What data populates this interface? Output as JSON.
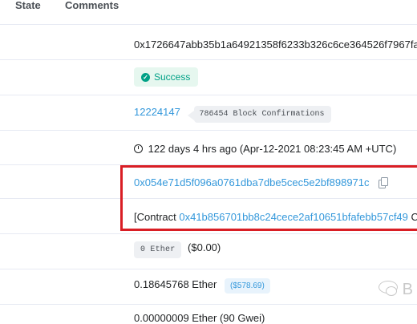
{
  "tabs": {
    "state": "State",
    "comments": "Comments"
  },
  "tx": {
    "hash": "0x1726647abb35b1a64921358f6233b326c6ce364526f7967fa",
    "status": "Success",
    "block_number": "12224147",
    "block_confirmations": "786454 Block Confirmations",
    "timestamp": "122 days 4 hrs ago (Apr-12-2021 08:23:45 AM +UTC)",
    "from_address": "0x054e71d5f096a0761dba7dbe5cec5e2bf898971c",
    "to_prefix": "[Contract ",
    "to_address": "0x41b856701bb8c24cece2af10651bfafebb57cf49",
    "to_suffix": " C",
    "value_amount": "0 Ether",
    "value_usd": "($0.00)",
    "fee": "0.18645768 Ether",
    "fee_usd": "($578.69)",
    "gas_price": "0.00000009 Ether (90 Gwei)"
  },
  "watermark": {
    "text": "B",
    "icon": "wechat-bubble-icon"
  },
  "colors": {
    "link": "#3498db",
    "success": "#00a186",
    "highlight": "#d91e25"
  }
}
